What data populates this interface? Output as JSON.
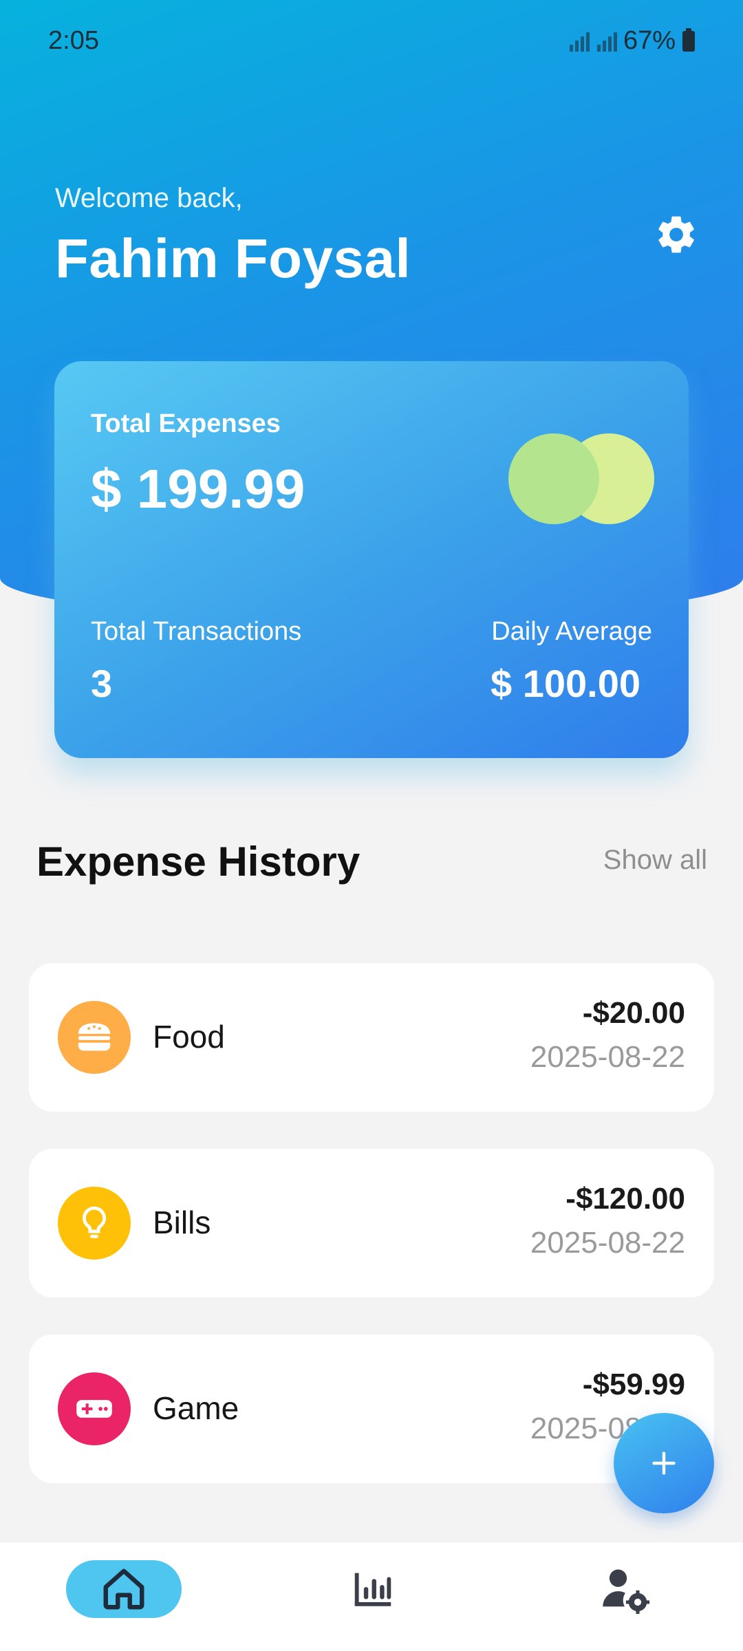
{
  "status_bar": {
    "time": "2:05",
    "battery": "67%"
  },
  "header": {
    "welcome": "Welcome back,",
    "user_name": "Fahim Foysal"
  },
  "summary": {
    "total_expenses_label": "Total Expenses",
    "total_expenses_value": "$ 199.99",
    "transactions_label": "Total Transactions",
    "transactions_value": "3",
    "daily_avg_label": "Daily Average",
    "daily_avg_value": "$ 100.00",
    "circle_colors": [
      "#b4e48d",
      "#d8ef95"
    ]
  },
  "history": {
    "title": "Expense History",
    "show_all": "Show all",
    "items": [
      {
        "category": "Food",
        "amount": "-$20.00",
        "date": "2025-08-22",
        "icon": "burger-icon",
        "color": "#ffad47"
      },
      {
        "category": "Bills",
        "amount": "-$120.00",
        "date": "2025-08-22",
        "icon": "lightbulb-icon",
        "color": "#ffc107"
      },
      {
        "category": "Game",
        "amount": "-$59.99",
        "date": "2025-08-22",
        "icon": "gamepad-icon",
        "color": "#ea2467"
      }
    ]
  },
  "fab": {
    "icon": "plus-icon"
  },
  "bottom_nav": [
    {
      "name": "home",
      "icon": "home-icon",
      "active": true
    },
    {
      "name": "stats",
      "icon": "bar-chart-icon",
      "active": false
    },
    {
      "name": "profile-settings",
      "icon": "user-gear-icon",
      "active": false
    }
  ],
  "colors": {
    "accent": "#2f80ec",
    "nav_active_bg": "#4fc6ef"
  }
}
